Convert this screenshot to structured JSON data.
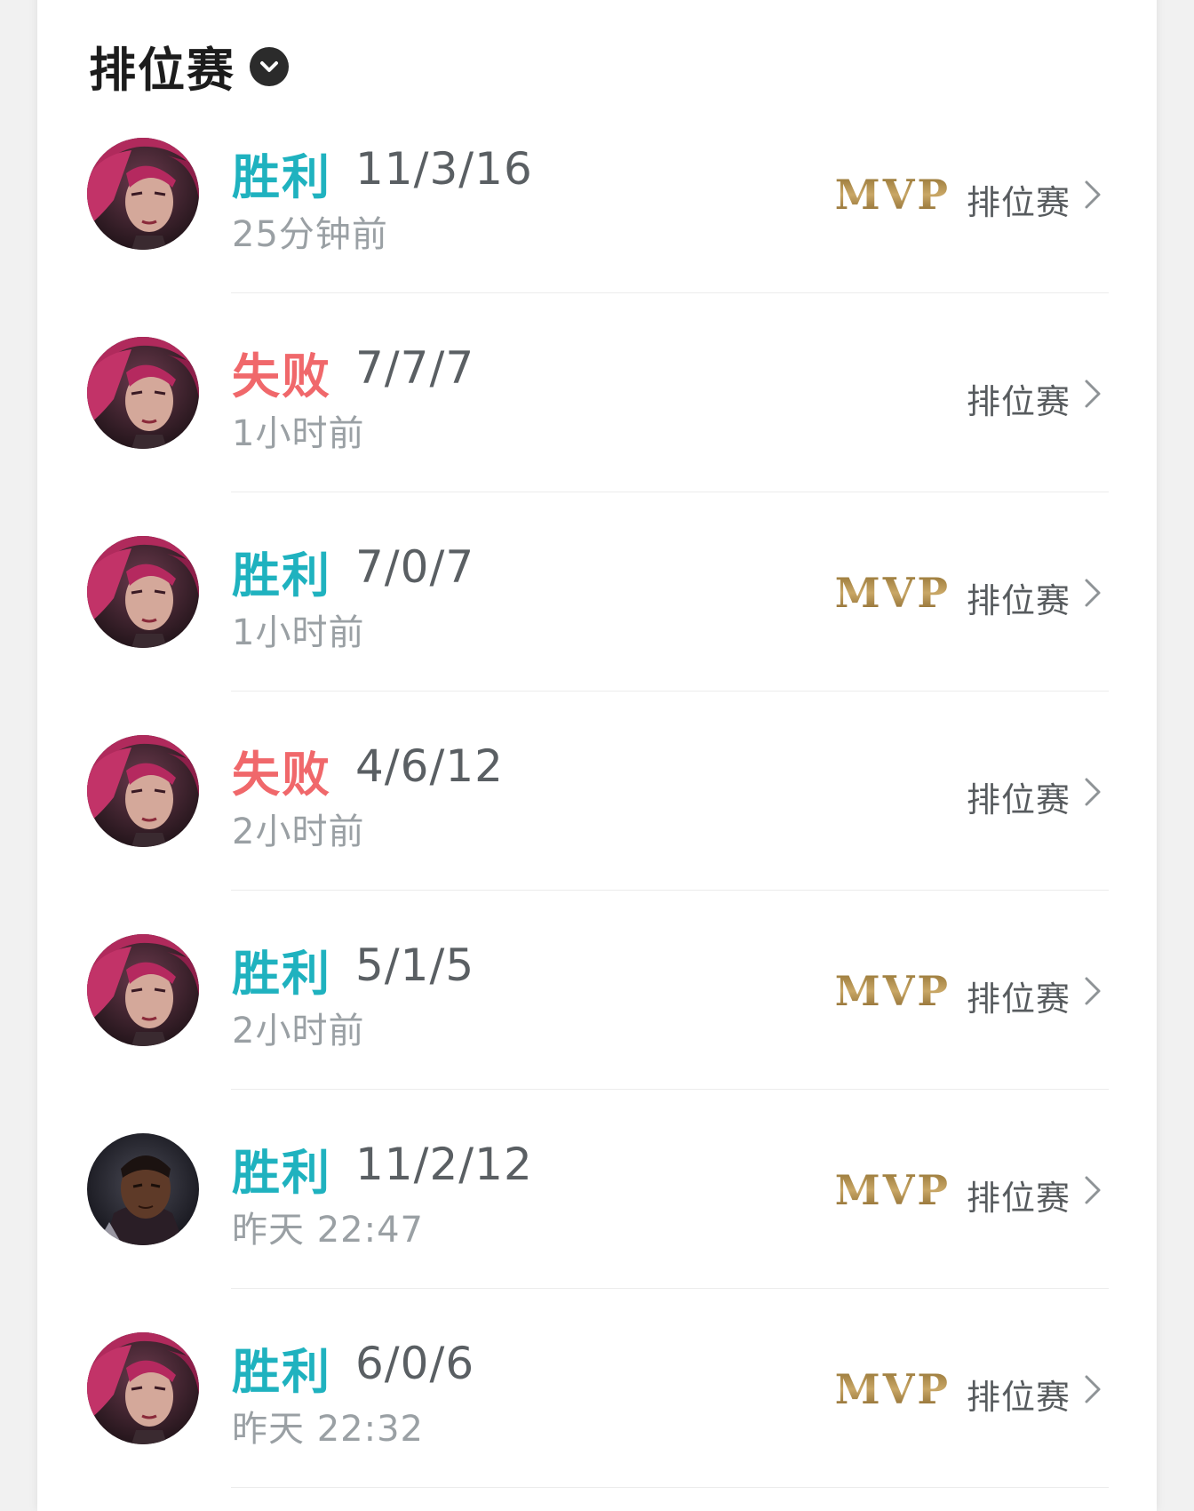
{
  "header": {
    "title": "排位赛"
  },
  "colors": {
    "win": "#1fb2bf",
    "loss": "#f0686b",
    "mvp": "#a07c3a"
  },
  "matches": [
    {
      "result": "胜利",
      "outcome": "win",
      "kda": "11/3/16",
      "time": "25分钟前",
      "mvp": "MVP",
      "mode": "排位赛",
      "champion": "pink-hair-champion"
    },
    {
      "result": "失败",
      "outcome": "loss",
      "kda": "7/7/7",
      "time": "1小时前",
      "mvp": "",
      "mode": "排位赛",
      "champion": "pink-hair-champion"
    },
    {
      "result": "胜利",
      "outcome": "win",
      "kda": "7/0/7",
      "time": "1小时前",
      "mvp": "MVP",
      "mode": "排位赛",
      "champion": "pink-hair-champion"
    },
    {
      "result": "失败",
      "outcome": "loss",
      "kda": "4/6/12",
      "time": "2小时前",
      "mvp": "",
      "mode": "排位赛",
      "champion": "pink-hair-champion"
    },
    {
      "result": "胜利",
      "outcome": "win",
      "kda": "5/1/5",
      "time": "2小时前",
      "mvp": "MVP",
      "mode": "排位赛",
      "champion": "pink-hair-champion"
    },
    {
      "result": "胜利",
      "outcome": "win",
      "kda": "11/2/12",
      "time": "昨天 22:47",
      "mvp": "MVP",
      "mode": "排位赛",
      "champion": "dark-skin-champion"
    },
    {
      "result": "胜利",
      "outcome": "win",
      "kda": "6/0/6",
      "time": "昨天 22:32",
      "mvp": "MVP",
      "mode": "排位赛",
      "champion": "pink-hair-champion"
    }
  ]
}
